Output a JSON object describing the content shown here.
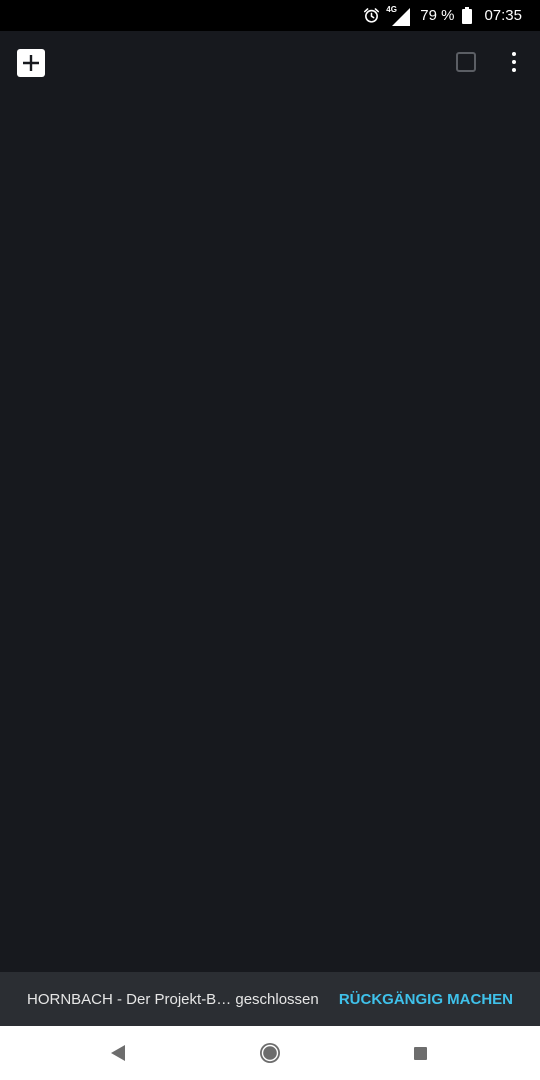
{
  "status_bar": {
    "alarm_icon": "alarm-clock-icon",
    "network_label": "4G",
    "signal_icon": "cell-signal-icon",
    "battery_percent": "79 %",
    "battery_icon": "battery-icon",
    "time": "07:35"
  },
  "toolbar": {
    "new_tab_icon": "plus-icon",
    "tab_switcher_icon": "tab-switcher-icon",
    "menu_icon": "more-vertical-icon"
  },
  "snackbar": {
    "message": "HORNBACH - Der Projekt-B… geschlossen",
    "action_label": "RÜCKGÄNGIG MACHEN",
    "action_color": "#3fc1ea"
  },
  "nav_bar": {
    "back_icon": "back-triangle-icon",
    "home_icon": "home-circle-icon",
    "recents_icon": "recents-square-icon"
  },
  "colors": {
    "background": "#17191e",
    "snackbar_bg": "#2b2e33",
    "status_bar_bg": "#000000"
  }
}
